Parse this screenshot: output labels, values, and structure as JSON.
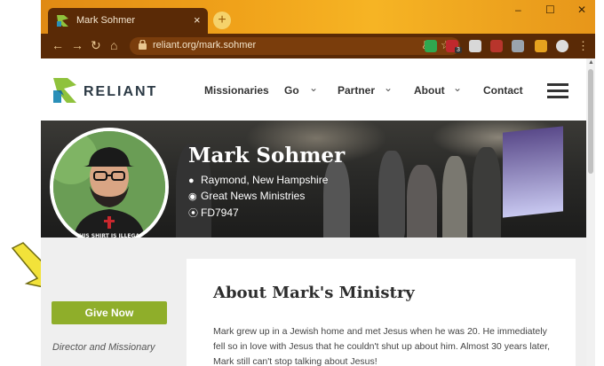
{
  "browser": {
    "tab_title": "Mark Sohmer",
    "tab_close": "×",
    "new_tab": "+",
    "url": "reliant.org/mark.sohmer",
    "window_controls": {
      "minimize": "–",
      "maximize": "☐",
      "close": "✕"
    },
    "nav_icons": [
      "back-icon",
      "forward-icon",
      "reload-icon",
      "home-icon"
    ],
    "extension_badge": "3"
  },
  "site": {
    "logo_text": "RELIANT",
    "menu": [
      {
        "label": "Missionaries",
        "dropdown": false
      },
      {
        "label": "Go",
        "dropdown": true
      },
      {
        "label": "Partner",
        "dropdown": true
      },
      {
        "label": "About",
        "dropdown": true
      },
      {
        "label": "Contact",
        "dropdown": false
      }
    ]
  },
  "profile": {
    "name": "Mark Sohmer",
    "location": "Raymond, New Hampshire",
    "ministry": "Great News Ministries",
    "code": "FD7947",
    "shirt_text": "THIS SHIRT IS ILLEGAL"
  },
  "sidebar": {
    "give_button": "Give Now",
    "role": "Director and Missionary"
  },
  "about": {
    "heading": "About Mark's Ministry",
    "body": "Mark grew up in a Jewish home and met Jesus when he was 20. He immediately fell so in love with Jesus that he couldn't shut up about him. Almost 30 years later, Mark still can't stop talking about Jesus!"
  },
  "colors": {
    "browser_frame": "#f0a21a",
    "browser_dark": "#5a2a06",
    "give_button": "#8fae2a",
    "logo_green": "#8fc23c",
    "logo_blue": "#2a8fb8",
    "annotation_arrow": "#f2e23a"
  }
}
